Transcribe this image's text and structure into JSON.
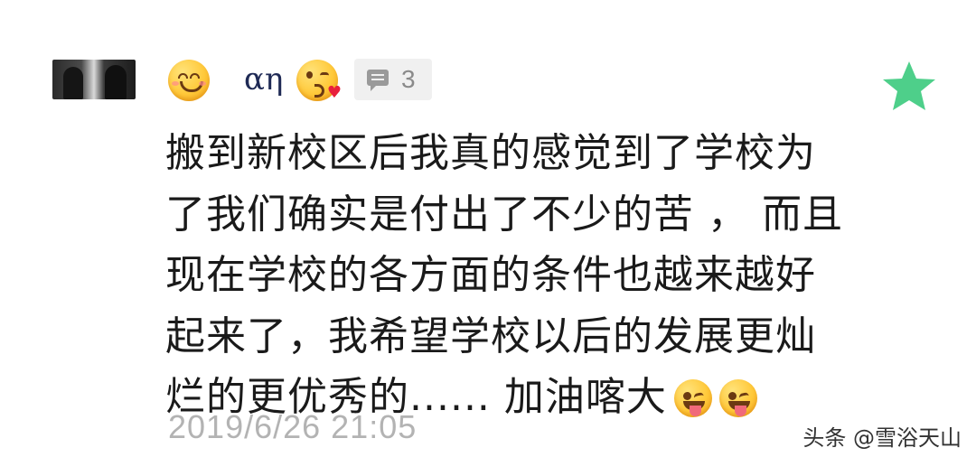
{
  "user": {
    "name": "αη",
    "avatar_icon": "profile-photo",
    "emoji_before": "smiling-face-emoji",
    "emoji_after": "face-blowing-kiss-emoji"
  },
  "comment_badge": {
    "icon": "comment-icon",
    "count": "3"
  },
  "favorite": {
    "icon": "star-icon",
    "color": "#4ecf8a"
  },
  "content": {
    "lines": [
      "搬到新校区后我真的感觉到了学校为",
      "了我们确实是付出了不少的苦 ， 而且",
      "现在学校的各方面的条件也越来越好",
      "起来了，我希望学校以后的发展更灿",
      "烂的更优秀的......  加油喀大"
    ],
    "trailing_emojis": [
      "winking-face-with-tongue-emoji",
      "winking-face-with-tongue-emoji"
    ]
  },
  "timestamp": "2019/6/26 21:05",
  "watermark": "头条 @雪浴天山"
}
